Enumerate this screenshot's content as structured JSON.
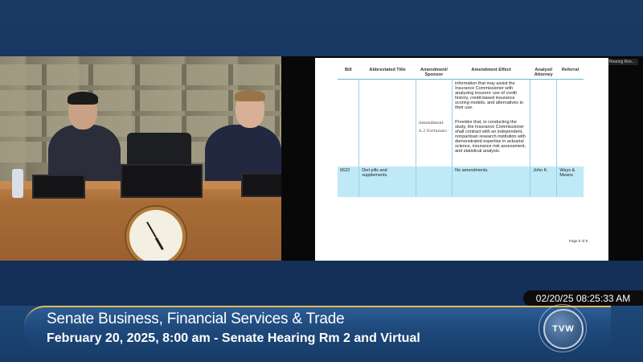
{
  "window": {
    "speaker_tag": "Talking: Senate Hearing Roo..."
  },
  "document": {
    "columns": [
      "Bill",
      "Abbreviated Title",
      "Amendment/ Sponsor",
      "Amendment Effect",
      "Analyst/ Attorney",
      "Referral"
    ],
    "rows": [
      {
        "bill": "",
        "title": "",
        "sponsor": "",
        "effect": "information that may assist the Insurance Commissioner with analyzing insurers' use of credit history, credit-based insurance scoring models, and alternatives to their use.",
        "analyst": "",
        "referral": ""
      },
      {
        "bill": "",
        "title": "",
        "sponsor": "Amendment A.2 Fortunato",
        "effect": "Provides that, in conducting the study, the Insurance Commissioner shall contract with an independent, nonpartisan research institution with demonstrated expertise in actuarial science, insurance risk assessment, and statistical analysis.",
        "analyst": "",
        "referral": ""
      },
      {
        "bill": "5622",
        "title": "Diet pills and supplements",
        "sponsor": "",
        "effect": "No amendments.",
        "analyst": "John K.",
        "referral": "Ways & Means"
      }
    ],
    "page_label": "Page 5 of 8"
  },
  "broadcast": {
    "timestamp": "02/20/25 08:25:33 AM",
    "title": "Senate Business, Financial Services & Trade",
    "subtitle": "February 20, 2025, 8:00 am - Senate Hearing Rm 2 and Virtual",
    "logo_text": "TVW"
  },
  "colors": {
    "accent_gold": "#e1b95b",
    "highlight_row": "#bfe9f6",
    "table_rule": "#6fb7d8"
  }
}
